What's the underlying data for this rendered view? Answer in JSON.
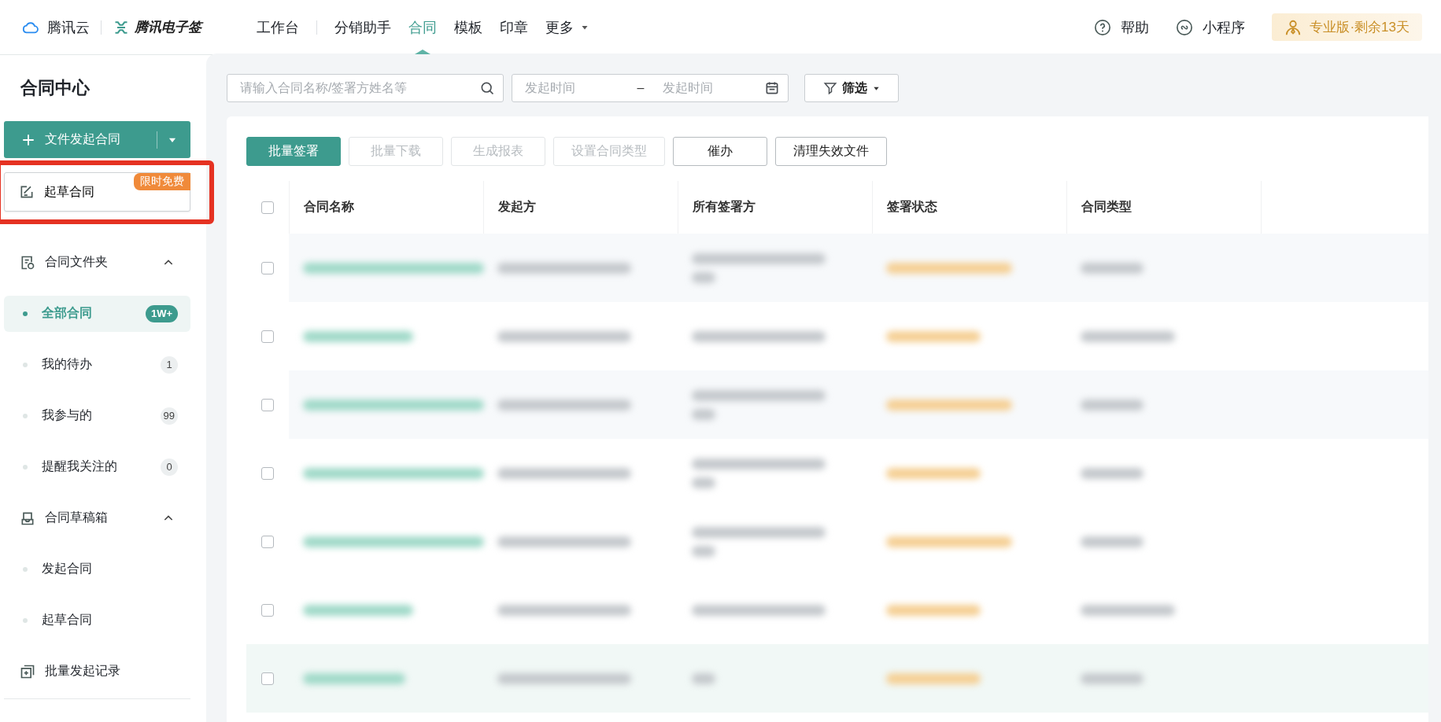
{
  "topbar": {
    "brand": "腾讯云",
    "product": "腾讯电子签",
    "workbench": "工作台",
    "nav": [
      {
        "label": "分销助手",
        "kind": "link",
        "selected": false
      },
      {
        "label": "合同",
        "kind": "link",
        "selected": true
      },
      {
        "label": "模板",
        "kind": "link",
        "selected": false
      },
      {
        "label": "印章",
        "kind": "link",
        "selected": false
      },
      {
        "label": "更多",
        "kind": "dropdown",
        "selected": false
      }
    ],
    "help": "帮助",
    "mini_program": "小程序",
    "plan": "专业版·剩余13天"
  },
  "sidebar": {
    "title": "合同中心",
    "primary_button": "文件发起合同",
    "draft_button": {
      "label": "起草合同",
      "badge": "限时免费",
      "highlighted": true
    },
    "sections": [
      {
        "kind": "group",
        "label": "合同文件夹",
        "expanded": true,
        "children": [
          {
            "label": "全部合同",
            "count": "1W+",
            "selected": true
          },
          {
            "label": "我的待办",
            "count": "1",
            "selected": false
          },
          {
            "label": "我参与的",
            "count": "99",
            "selected": false
          },
          {
            "label": "提醒我关注的",
            "count": "0",
            "selected": false
          }
        ]
      },
      {
        "kind": "group",
        "label": "合同草稿箱",
        "expanded": true,
        "children": [
          {
            "label": "发起合同",
            "selected": false
          },
          {
            "label": "起草合同",
            "selected": false
          }
        ]
      },
      {
        "kind": "link",
        "label": "批量发起记录"
      }
    ]
  },
  "filters": {
    "search": {
      "placeholder": "请输入合同名称/签署方姓名等"
    },
    "date_start": {
      "placeholder": "发起时间"
    },
    "date_separator": "–",
    "date_end": {
      "placeholder": "发起时间"
    },
    "filter_button": "筛选"
  },
  "actions": [
    {
      "label": "批量签署",
      "kind": "primary",
      "disabled": false
    },
    {
      "label": "批量下载",
      "kind": "default",
      "disabled": true
    },
    {
      "label": "生成报表",
      "kind": "default",
      "disabled": true
    },
    {
      "label": "设置合同类型",
      "kind": "default",
      "disabled": true
    },
    {
      "label": "催办",
      "kind": "default",
      "disabled": false
    },
    {
      "label": "清理失效文件",
      "kind": "default",
      "disabled": false
    }
  ],
  "table": {
    "header_checked": false,
    "columns": [
      "合同名称",
      "发起方",
      "所有签署方",
      "签署状态",
      "合同类型"
    ],
    "rows": [
      {
        "checked": false,
        "selected": false
      },
      {
        "checked": false,
        "selected": false
      },
      {
        "checked": false,
        "selected": false
      },
      {
        "checked": false,
        "selected": false
      },
      {
        "checked": false,
        "selected": false
      },
      {
        "checked": false,
        "selected": false
      },
      {
        "checked": false,
        "selected": true
      }
    ]
  }
}
